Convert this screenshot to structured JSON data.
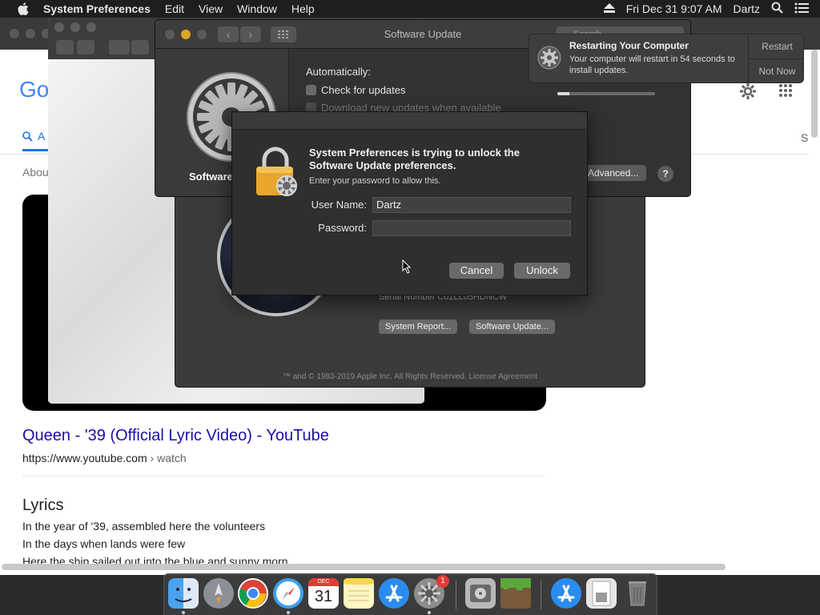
{
  "menubar": {
    "app_name": "System Preferences",
    "menus": [
      "Edit",
      "View",
      "Window",
      "Help"
    ],
    "datetime": "Fri Dec 31  9:07 AM",
    "user": "Dartz"
  },
  "browser": {
    "logo_text": "Go",
    "tab_all": "A",
    "about_text": "Abou",
    "right_tab_text": "S",
    "result_title": "Queen - '39 (Official Lyric Video) - YouTube",
    "result_url": "https://www.youtube.com",
    "result_url_crumb": " › watch",
    "lyrics_heading": "Lyrics",
    "lyrics_lines": [
      "In the year of '39, assembled here the volunteers",
      "In the days when lands were few",
      "Here the ship sailed out into the blue and sunny morn"
    ]
  },
  "software_update": {
    "title": "Software Update",
    "search_placeholder": "Search",
    "left_label": "Software",
    "automatically": "Automatically:",
    "check_updates": "Check for updates",
    "download_updates": "Download new updates when available",
    "advanced_button": "Advanced...",
    "help_button": "?",
    "progress": 0.12
  },
  "about_mac": {
    "serial": "Serial Number   C02LL05HDNCW",
    "system_report_button": "System Report...",
    "software_update_button": "Software Update...",
    "footer": "™ and © 1983-2019 Apple Inc. All Rights Reserved. License Agreement"
  },
  "auth_dialog": {
    "heading": "System Preferences is trying to unlock the Software Update preferences.",
    "subtext": "Enter your password to allow this.",
    "username_label": "User Name:",
    "username_value": "Dartz",
    "password_label": "Password:",
    "password_value": "",
    "cancel_button": "Cancel",
    "unlock_button": "Unlock"
  },
  "notification": {
    "title": "Restarting Your Computer",
    "body": "Your computer will restart in 54 seconds to install updates.",
    "restart_button": "Restart",
    "not_now_button": "Not Now"
  },
  "dock": {
    "items": [
      "finder-icon",
      "launchpad-icon",
      "chrome-icon",
      "safari-icon",
      "calendar-icon",
      "notes-icon",
      "app-store-icon",
      "system-preferences-icon",
      "disk-utility-icon",
      "minecraft-icon",
      "app-store-download-icon",
      "preview-icon",
      "trash-icon"
    ],
    "calendar_month": "DEC",
    "calendar_day": "31",
    "sysprefs_badge": "1"
  },
  "colors": {
    "accent_blue": "#1a73e8",
    "link_color": "#1a0dab",
    "lock_gold": "#e8a62c"
  }
}
